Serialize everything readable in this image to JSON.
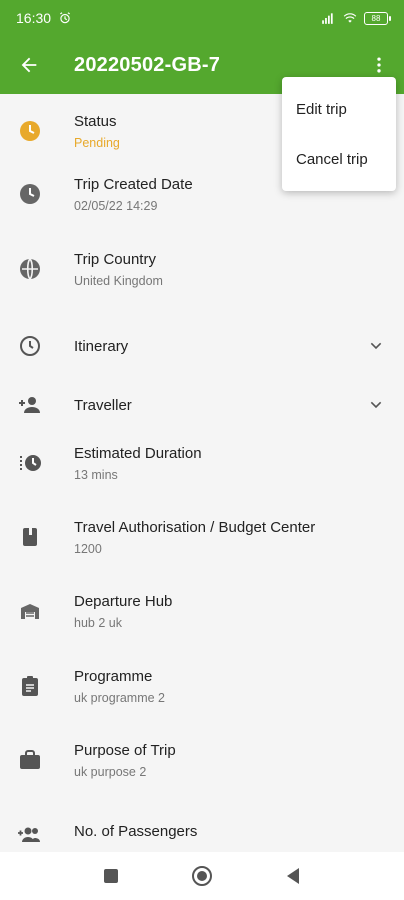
{
  "status_bar": {
    "time": "16:30",
    "battery": "88"
  },
  "header": {
    "title": "20220502-GB-7"
  },
  "menu": {
    "items": [
      {
        "label": "Edit trip"
      },
      {
        "label": "Cancel trip"
      }
    ]
  },
  "details": [
    {
      "label": "Status",
      "value": "Pending",
      "icon": "clock-filled-icon"
    },
    {
      "label": "Trip Created Date",
      "value": "02/05/22 14:29",
      "icon": "clock-icon"
    },
    {
      "label": "Trip Country",
      "value": "United Kingdom",
      "icon": "globe-icon"
    },
    {
      "label": "Itinerary",
      "value": "",
      "icon": "clock-outline-icon"
    },
    {
      "label": "Traveller",
      "value": "",
      "icon": "person-add-icon"
    },
    {
      "label": "Estimated Duration",
      "value": "13 mins",
      "icon": "timer-icon"
    },
    {
      "label": "Travel Authorisation / Budget Center",
      "value": "1200",
      "icon": "book-icon"
    },
    {
      "label": "Departure Hub",
      "value": "hub 2 uk",
      "icon": "garage-icon"
    },
    {
      "label": "Programme",
      "value": "uk programme 2",
      "icon": "clipboard-icon"
    },
    {
      "label": "Purpose of Trip",
      "value": "uk purpose 2",
      "icon": "briefcase-icon"
    },
    {
      "label": "No. of Passengers",
      "value": "",
      "icon": "group-add-icon"
    }
  ],
  "colors": {
    "primary": "#54a82e",
    "pending": "#e8a92b"
  }
}
